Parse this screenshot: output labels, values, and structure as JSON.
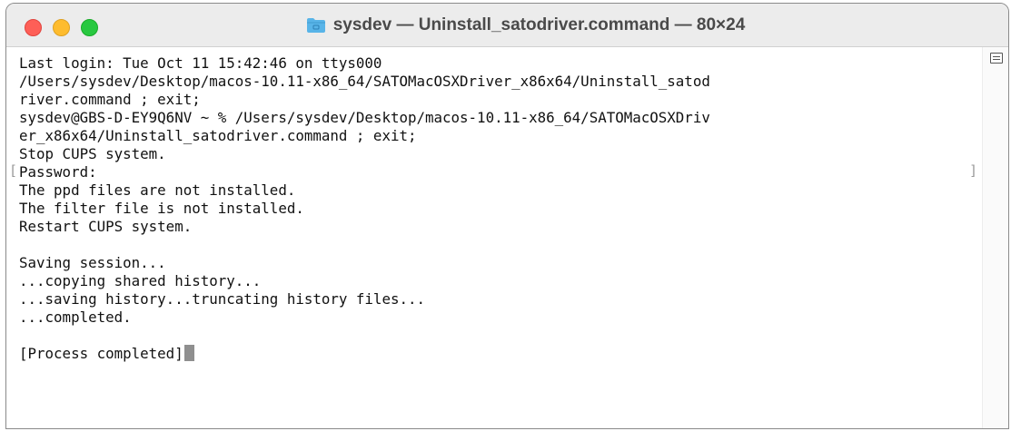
{
  "window": {
    "title": "sysdev — Uninstall_satodriver.command — 80×24",
    "title_icon": "folder-icon"
  },
  "terminal": {
    "lines": [
      "Last login: Tue Oct 11 15:42:46 on ttys000",
      "/Users/sysdev/Desktop/macos-10.11-x86_64/SATOMacOSXDriver_x86x64/Uninstall_satod",
      "river.command ; exit;",
      "sysdev@GBS-D-EY9Q6NV ~ % /Users/sysdev/Desktop/macos-10.11-x86_64/SATOMacOSXDriv",
      "er_x86x64/Uninstall_satodriver.command ; exit;",
      "Stop CUPS system.",
      "Password:",
      "The ppd files are not installed.",
      "The filter file is not installed.",
      "Restart CUPS system.",
      "",
      "Saving session...",
      "...copying shared history...",
      "...saving history...truncating history files...",
      "...completed.",
      "",
      "[Process completed]"
    ],
    "mark_left": "[",
    "mark_right": "]"
  },
  "colors": {
    "close": "#fe5f57",
    "minimize": "#febc2e",
    "zoom": "#28c840",
    "folder": "#58b4e8"
  }
}
